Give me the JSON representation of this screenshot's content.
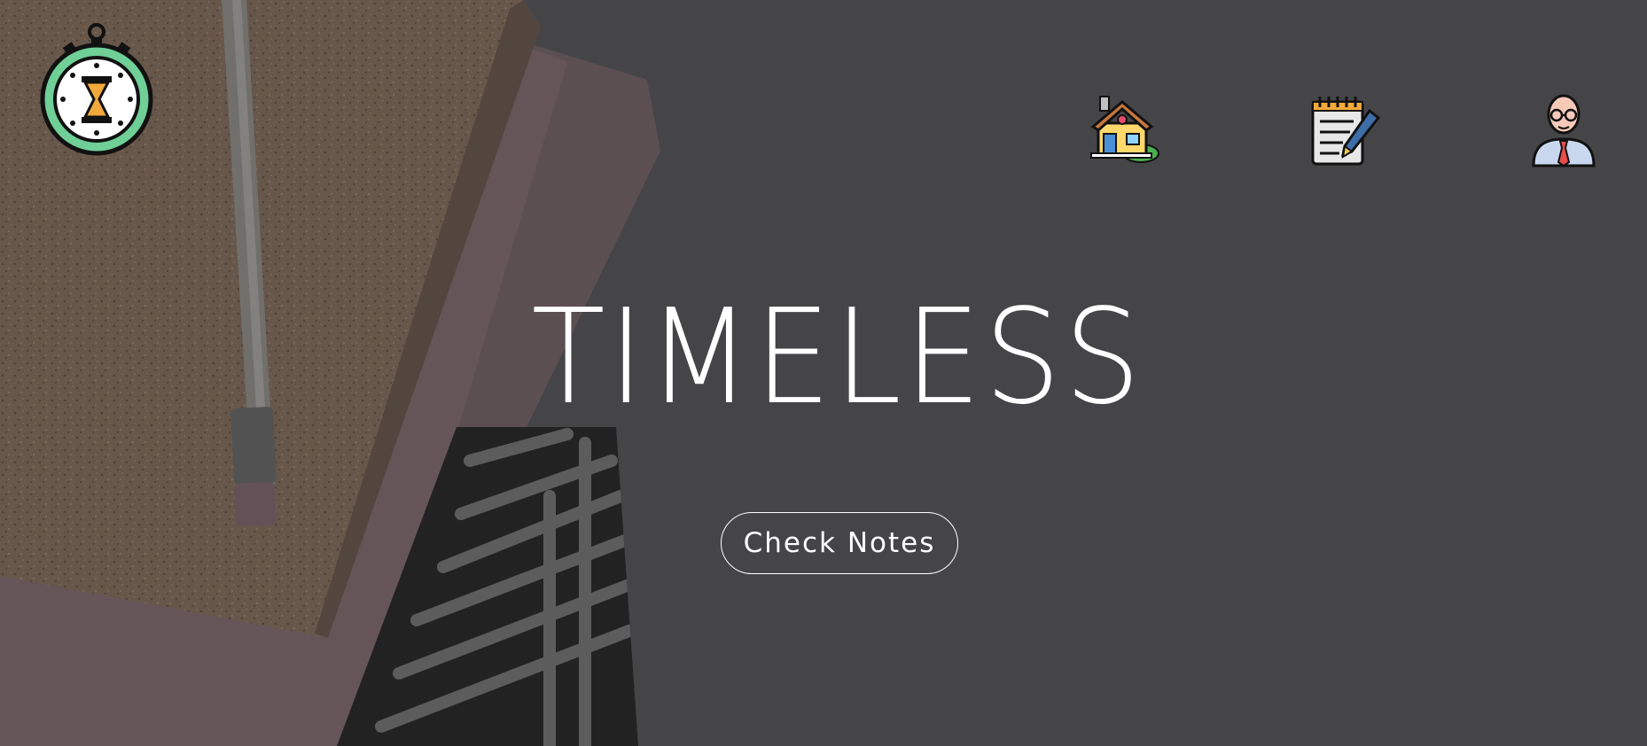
{
  "hero": {
    "title": "TIMELESS",
    "cta_label": "Check Notes"
  },
  "nav": {
    "items": [
      {
        "icon": "house-icon"
      },
      {
        "icon": "notepad-pen-icon"
      },
      {
        "icon": "professor-avatar-icon"
      }
    ]
  },
  "logo": {
    "icon": "stopwatch-hourglass-icon"
  },
  "colors": {
    "overlay": "#4a4b4c",
    "text": "#ffffff",
    "cork": "#8a6f55",
    "pink_notebook": "#7c5e63",
    "stripes_dark": "#111111",
    "stripes_light": "#8a8a8a",
    "logo_ring": "#6fcf97",
    "hourglass": "#f2a93b"
  }
}
